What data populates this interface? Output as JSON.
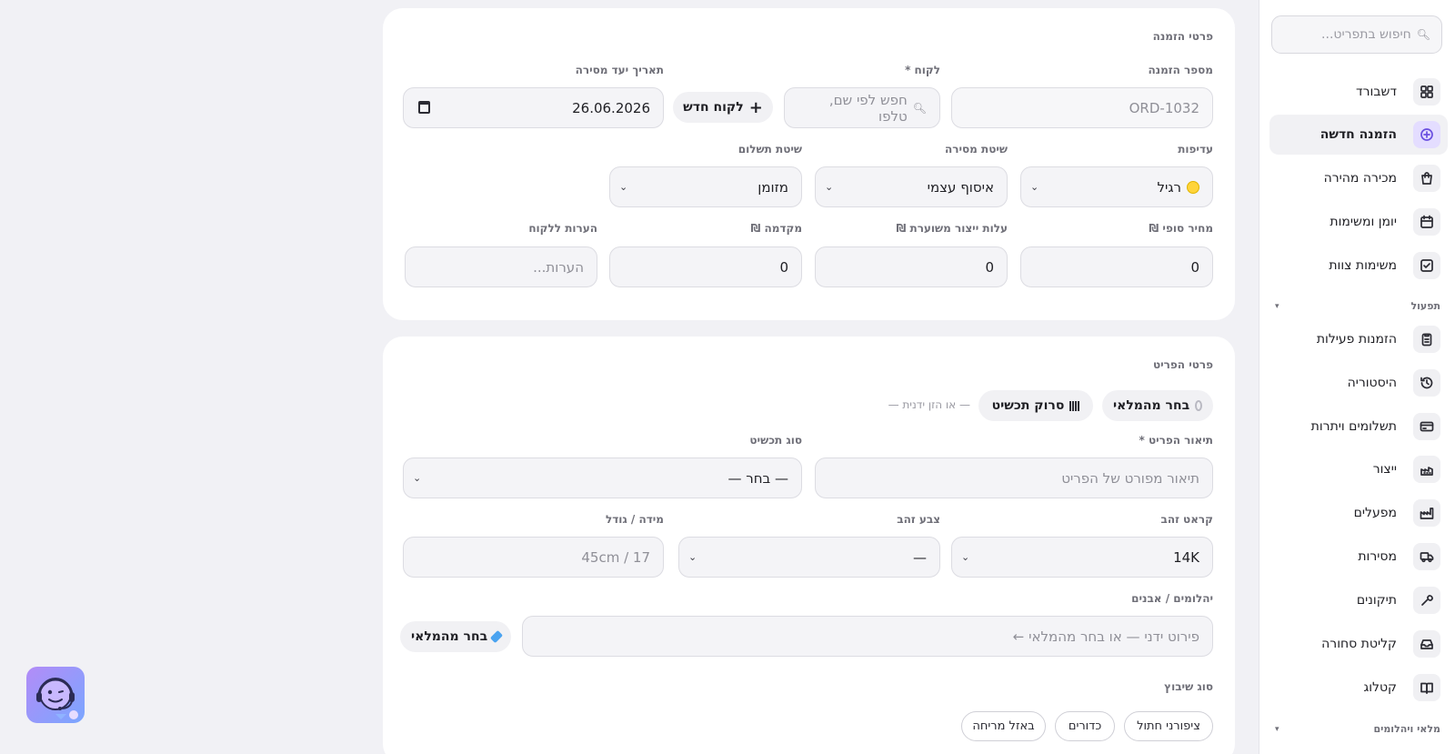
{
  "sidebar": {
    "search_placeholder": "חיפוש בתפריט...",
    "items": [
      {
        "label": "דשבורד",
        "icon": "grid-icon"
      },
      {
        "label": "הזמנה חדשה",
        "icon": "plus-circle-icon"
      },
      {
        "label": "מכירה מהירה",
        "icon": "shopping-bag-icon"
      },
      {
        "label": "יומן ומשימות",
        "icon": "calendar-icon"
      },
      {
        "label": "משימות צוות",
        "icon": "checkbox-icon"
      }
    ],
    "section_operations": "תפעול",
    "ops_items": [
      {
        "label": "הזמנות פעילות",
        "icon": "clipboard-icon"
      },
      {
        "label": "היסטוריה",
        "icon": "history-icon"
      },
      {
        "label": "תשלומים ויתרות",
        "icon": "credit-card-icon"
      },
      {
        "label": "ייצור",
        "icon": "factory-icon"
      },
      {
        "label": "מפעלים",
        "icon": "industry-icon"
      },
      {
        "label": "מסירות",
        "icon": "truck-icon"
      },
      {
        "label": "תיקונים",
        "icon": "wrench-icon"
      },
      {
        "label": "קליטת סחורה",
        "icon": "inbox-icon"
      },
      {
        "label": "קטלוג",
        "icon": "book-icon"
      }
    ],
    "section_inventory": "מלאי ויהלומים"
  },
  "order": {
    "title": "פרטי הזמנה",
    "order_number_label": "מספר הזמנה",
    "order_number_value": "ORD-1032",
    "customer_label": "לקוח *",
    "customer_placeholder": "חפש לפי שם, טלפו",
    "new_customer_label": "לקוח חדש",
    "delivery_date_label": "תאריך יעד מסירה",
    "delivery_date_value": "26.06.2026",
    "priority_label": "עדיפות",
    "priority_value": "רגיל",
    "delivery_method_label": "שיטת מסירה",
    "delivery_method_value": "איסוף עצמי",
    "payment_method_label": "שיטת תשלום",
    "payment_method_value": "מזומן",
    "final_price_label": "מחיר סופי ₪",
    "final_price_value": "0",
    "production_cost_label": "עלות ייצור משוערת ₪",
    "production_cost_value": "0",
    "deposit_label": "מקדמה ₪",
    "deposit_value": "0",
    "notes_label": "הערות ללקוח",
    "notes_placeholder": "הערות..."
  },
  "item": {
    "title": "פרטי הפריט",
    "choose_stock_label": "בחר מהמלאי",
    "scan_label": "סרוק תכשיט",
    "manual_hint": "— או הזן ידנית —",
    "description_label": "תיאור הפריט *",
    "description_placeholder": "תיאור מפורט של הפריט",
    "jewelry_type_label": "סוג תכשיט",
    "jewelry_type_value": "— בחר —",
    "karat_label": "קראט זהב",
    "karat_value": "14K",
    "gold_color_label": "צבע זהב",
    "gold_color_value": "—",
    "size_label": "מידה / גודל",
    "size_placeholder": "45cm / 17",
    "stones_label": "יהלומים / אבנים",
    "stones_placeholder": "פירוט ידני — או בחר מהמלאי ←",
    "stones_stock_label": "בחר מהמלאי",
    "setting_label": "סוג שיבוץ",
    "setting_options": [
      "ציפורני חתול",
      "כדורים",
      "באזל מריחה"
    ]
  },
  "colors": {
    "accent": "#6a4fe0",
    "accent_soft": "#e4ddff"
  }
}
